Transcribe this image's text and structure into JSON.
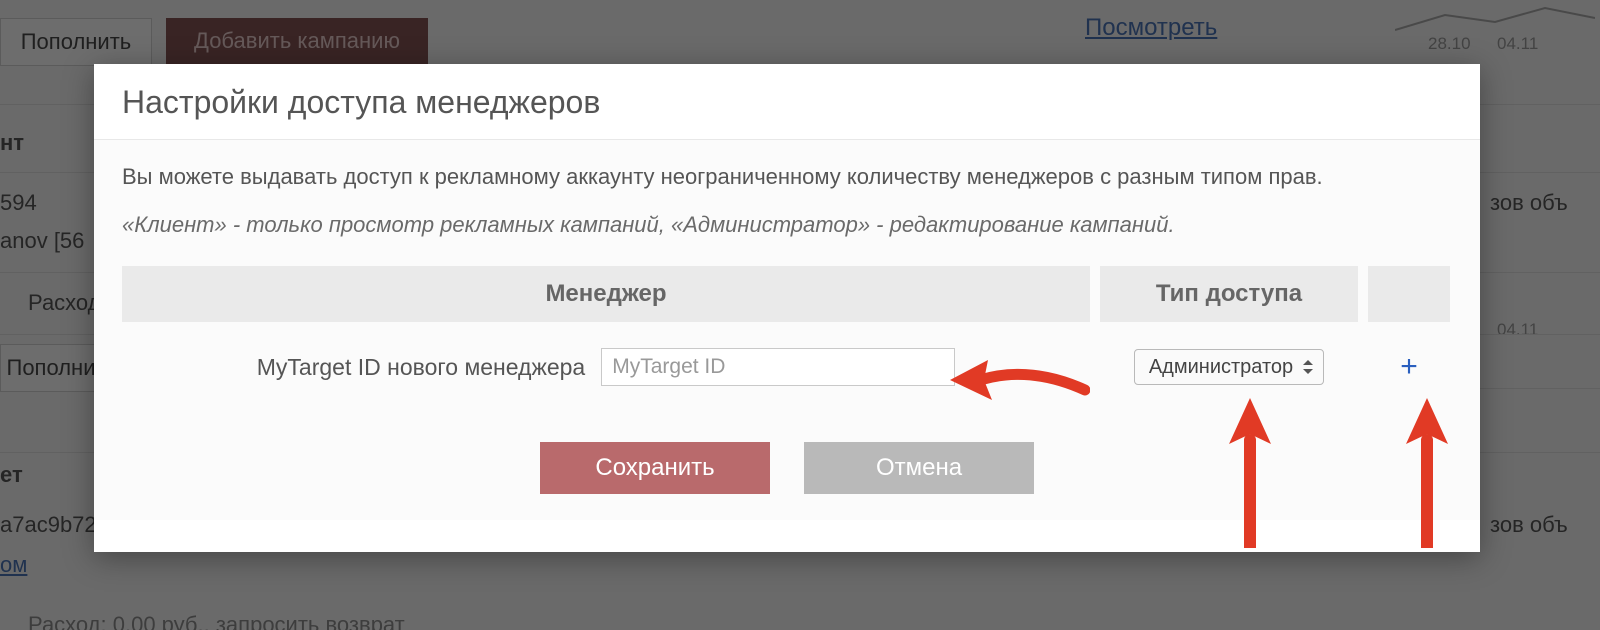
{
  "bg": {
    "topup_btn": "Пополнить",
    "add_campaign_btn": "Добавить кампанию",
    "view_link": "Посмотреть",
    "date1": "28.10",
    "date2": "04.11",
    "date3": "04.11",
    "frag_nt": "нт",
    "frag_594": "594",
    "frag_anov": "anov [56",
    "frag_rash": "Расход",
    "topup_btn2": "Пополни",
    "frag_et": "ет",
    "frag_hash": "a7ac9b72",
    "frag_om": "ом",
    "frag_bottom": "Расход: 0.00 руб., запросить возврат",
    "frag_right1": "зов объ",
    "frag_right2": "зов объ"
  },
  "modal": {
    "title": "Настройки доступа менеджеров",
    "desc1": "Вы можете выдавать доступ к рекламному аккаунту неограниченному количеству менеджеров с разным типом прав.",
    "desc2": "«Клиент» - только просмотр рекламных кампаний, «Администратор» - редактирование кампаний.",
    "col_manager": "Менеджер",
    "col_type": "Тип доступа",
    "row_label": "MyTarget ID нового менеджера",
    "row_placeholder": "MyTarget ID",
    "select_value": "Администратор",
    "plus": "+",
    "save": "Сохранить",
    "cancel": "Отмена"
  },
  "colors": {
    "accent_red": "#b96a6c",
    "arrow_red": "#e13a25"
  }
}
